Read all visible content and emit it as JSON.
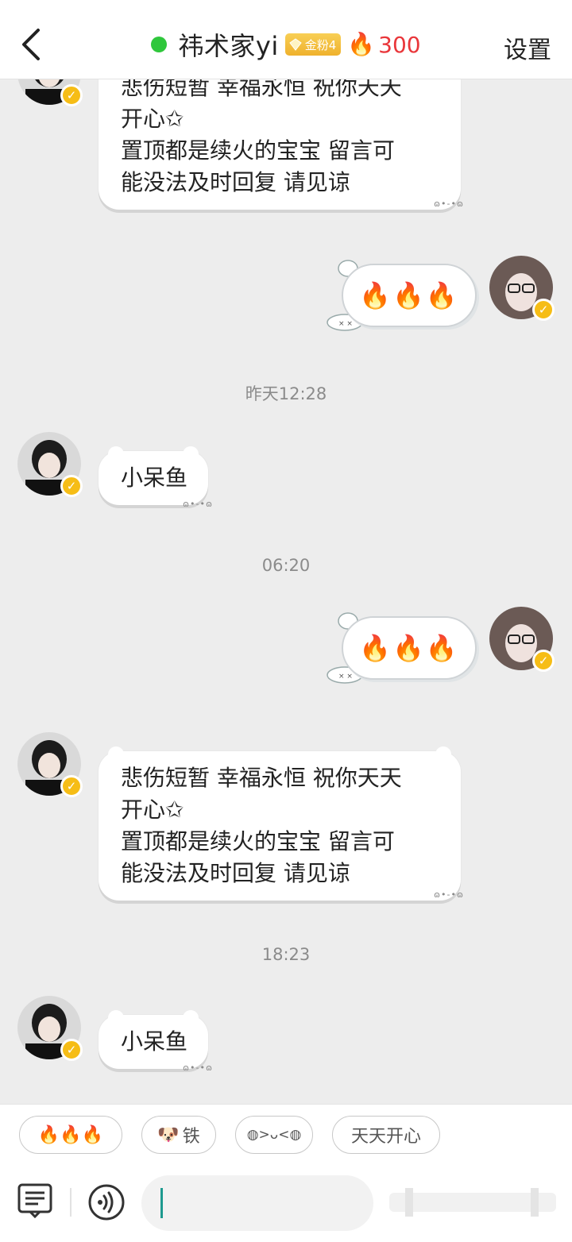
{
  "header": {
    "title": "祎术家yi",
    "fan_badge": "金粉4",
    "fire_icon": "🔥",
    "streak": "300",
    "settings_label": "设置",
    "online_color": "#2fc73c",
    "streak_color": "#e9363a"
  },
  "messages": {
    "top_partial": "悲伤短暂 幸福永恒 祝你天天\n开心✩\n置顶都是续火的宝宝 留言可\n能没法及时回复 请见谅",
    "out1": "🔥🔥🔥",
    "time1": "昨天12:28",
    "in1": "小呆鱼",
    "time2": "06:20",
    "out2": "🔥🔥🔥",
    "in2": "悲伤短暂 幸福永恒 祝你天天\n开心✩\n置顶都是续火的宝宝 留言可\n能没法及时回复 请见谅",
    "time3": "18:23",
    "in3": "小呆鱼",
    "bubble_deco": "ɷ•-•ɷ"
  },
  "quick_replies": {
    "chip1": "🔥🔥🔥",
    "chip2_icon": "🐶",
    "chip2_text": "铁",
    "chip3": "◍>ᴗ<◍",
    "chip4": "天天开心"
  },
  "input": {
    "value": ""
  },
  "colors": {
    "badge_gold": "#f6bd16",
    "caret": "#1e9a8f"
  },
  "icons": [
    "back-icon",
    "online-dot",
    "gem-icon",
    "flame-icon",
    "verified-icon",
    "menu-icon",
    "voice-icon"
  ]
}
